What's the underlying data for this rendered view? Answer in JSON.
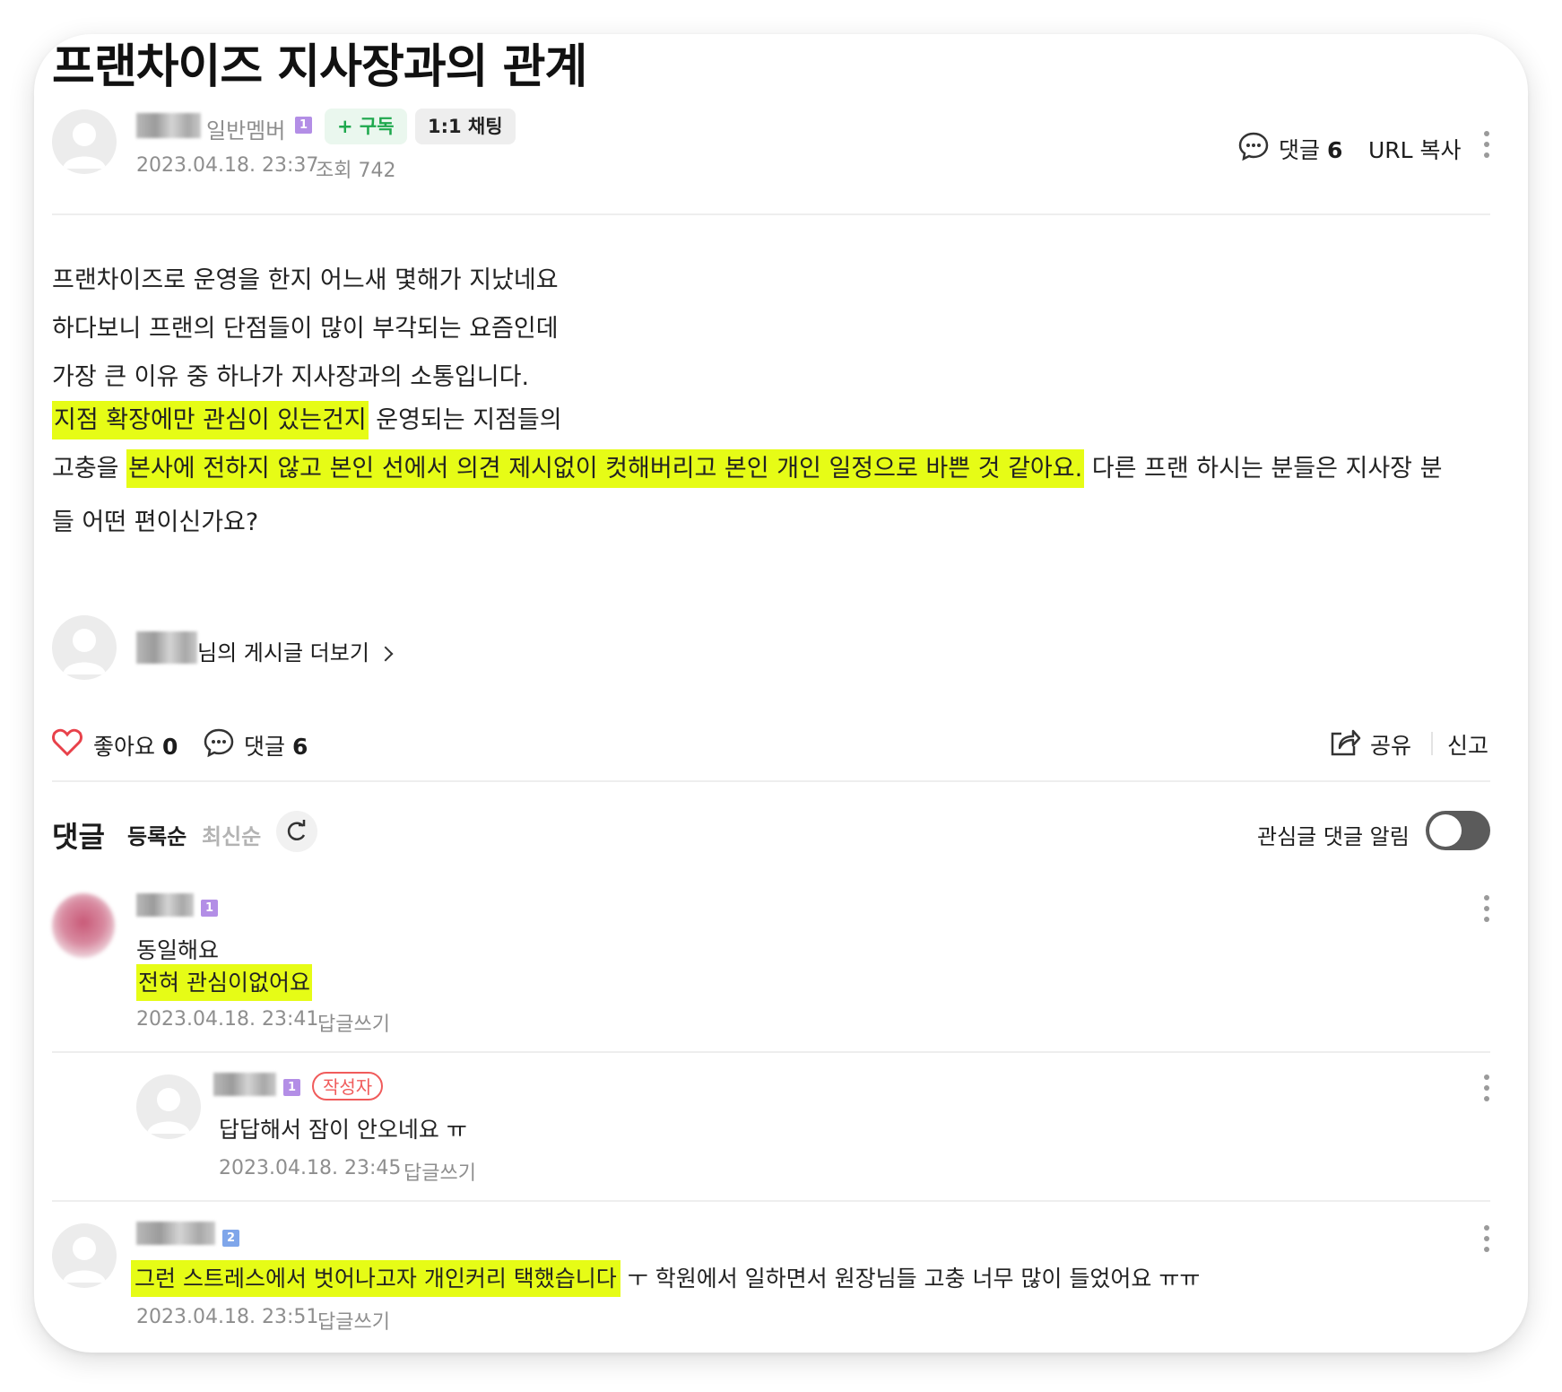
{
  "post": {
    "title": "프랜차이즈 지사장과의 관계",
    "author_grade": "일반멤버",
    "author_level": "1",
    "subscribe_label": "+ 구독",
    "chat_label": "1:1 채팅",
    "date": "2023.04.18. 23:37",
    "views": "조회 742",
    "comment_label": "댓글",
    "comment_count": "6",
    "url_copy_label": "URL 복사",
    "body_lines": [
      "프랜차이즈로 운영을 한지 어느새 몇해가 지났네요",
      "하다보니 프랜의 단점들이 많이 부각되는 요즘인데",
      "가장 큰 이유 중 하나가 지사장과의 소통입니다."
    ],
    "line4_highlight": "지점 확장에만 관심이 있는건지",
    "line4_rest": " 운영되는 지점들의",
    "line5_pre": "고충을 ",
    "line5_highlight": "본사에 전하지 않고 본인 선에서 의견 제시없이 컷해버리고 본인 개인 일정으로 바쁜 것 같아요.",
    "line5_rest": " 다른 프랜 하시는 분들은 지사장 분",
    "line6": "들 어떤 편이신가요?",
    "more_posts_label": "님의 게시글 더보기",
    "like_label": "좋아요",
    "like_count": "0",
    "share_label": "공유",
    "report_label": "신고"
  },
  "comments_header": {
    "title": "댓글",
    "sort_registered": "등록순",
    "sort_latest": "최신순",
    "notify_label": "관심글 댓글 알림"
  },
  "comments": [
    {
      "level": "1",
      "line1": "동일해요",
      "line2_highlight": "전혀 관심이없어요",
      "date": "2023.04.18. 23:41",
      "reply_label": "답글쓰기"
    },
    {
      "level": "1",
      "author_badge": "작성자",
      "text": "답답해서 잠이 안오네요 ㅠ",
      "date": "2023.04.18. 23:45",
      "reply_label": "답글쓰기"
    },
    {
      "level": "2",
      "text_highlight": "그런 스트레스에서 벗어나고자 개인커리 택했습니다",
      "text_rest": " ㅜ 학원에서 일하면서 원장님들 고충 너무 많이 들었어요 ㅠㅠ",
      "date": "2023.04.18. 23:51",
      "reply_label": "답글쓰기"
    }
  ],
  "colors": {
    "highlight": "#e6fc16",
    "like_heart": "#e8414a",
    "author_badge": "#f05b5b",
    "subscribe_green": "#1ea84d"
  }
}
